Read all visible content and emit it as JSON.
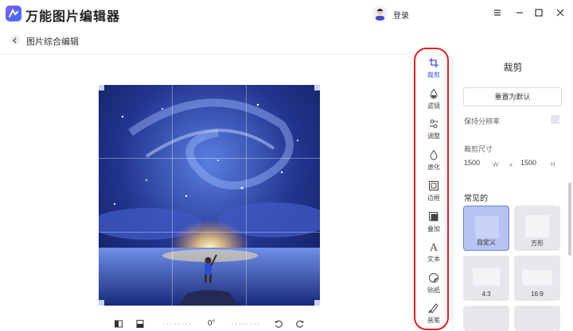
{
  "app": {
    "title": "万能图片编辑器",
    "login_label": "登录"
  },
  "window_controls": [
    "menu-icon",
    "minimize-icon",
    "maximize-icon",
    "close-icon"
  ],
  "breadcrumb": {
    "label": "图片综合编辑"
  },
  "canvas": {
    "rotation": "0°"
  },
  "tools": [
    {
      "id": "crop",
      "label": "裁剪",
      "icon": "crop-icon",
      "active": true
    },
    {
      "id": "filter",
      "label": "滤镜",
      "icon": "drop-icon",
      "active": false
    },
    {
      "id": "adjust",
      "label": "调整",
      "icon": "adjust-icon",
      "active": false
    },
    {
      "id": "blur",
      "label": "虚化",
      "icon": "blur-drop-icon",
      "active": false
    },
    {
      "id": "border",
      "label": "边框",
      "icon": "frame-icon",
      "active": false
    },
    {
      "id": "overlay",
      "label": "叠加",
      "icon": "layers-icon",
      "active": false
    },
    {
      "id": "text",
      "label": "文本",
      "icon": "text-icon",
      "active": false
    },
    {
      "id": "sticker",
      "label": "贴纸",
      "icon": "sticker-icon",
      "active": false
    },
    {
      "id": "brush",
      "label": "画笔",
      "icon": "brush-icon",
      "active": false
    }
  ],
  "panel": {
    "title": "裁剪",
    "reset_label": "重置为默认",
    "keep_resolution_label": "保持分辨率",
    "size_label": "裁剪尺寸",
    "width_value": "1500",
    "width_unit": "W",
    "times": "x",
    "height_value": "1500",
    "height_unit": "H",
    "common_label": "常见的",
    "presets": [
      "自定义",
      "方形",
      "4:3",
      "16:9"
    ]
  },
  "colors": {
    "accent": "#3b55e6",
    "highlight_border": "#e02020",
    "selected_card": "#b7c3f2"
  }
}
